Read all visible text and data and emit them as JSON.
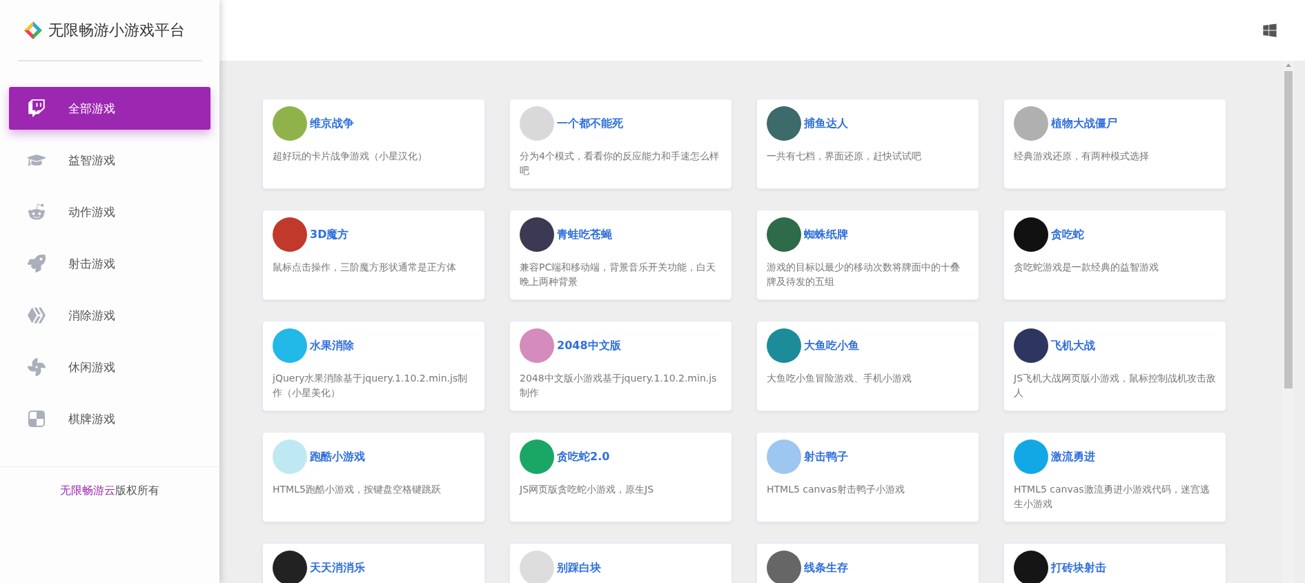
{
  "header": {
    "title": "无限畅游小游戏平台"
  },
  "sidebar": {
    "items": [
      {
        "label": "全部游戏",
        "selected": true
      },
      {
        "label": "益智游戏",
        "selected": false
      },
      {
        "label": "动作游戏",
        "selected": false
      },
      {
        "label": "射击游戏",
        "selected": false
      },
      {
        "label": "消除游戏",
        "selected": false
      },
      {
        "label": "休闲游戏",
        "selected": false
      },
      {
        "label": "棋牌游戏",
        "selected": false
      }
    ],
    "footer": {
      "brand": "无限畅游云",
      "text": "版权所有"
    }
  },
  "games": [
    {
      "title": "维京战争",
      "description": "超好玩的卡片战争游戏（小星汉化）"
    },
    {
      "title": "一个都不能死",
      "description": "分为4个模式，看看你的反应能力和手速怎么样吧"
    },
    {
      "title": "捕鱼达人",
      "description": "一共有七档，界面还原，赶快试试吧"
    },
    {
      "title": "植物大战僵尸",
      "description": "经典游戏还原，有两种模式选择"
    },
    {
      "title": "3D魔方",
      "description": "鼠标点击操作，三阶魔方形状通常是正方体"
    },
    {
      "title": "青蛙吃苍蝇",
      "description": "兼容PC端和移动端，背景音乐开关功能，白天晚上两种背景"
    },
    {
      "title": "蜘蛛纸牌",
      "description": "游戏的目标以最少的移动次数将牌面中的十叠牌及待发的五组"
    },
    {
      "title": "贪吃蛇",
      "description": "贪吃蛇游戏是一款经典的益智游戏"
    },
    {
      "title": "水果消除",
      "description": "jQuery水果消除基于jquery.1.10.2.min.js制作（小星美化）"
    },
    {
      "title": "2048中文版",
      "description": "2048中文版小游戏基于jquery.1.10.2.min.js制作"
    },
    {
      "title": "大鱼吃小鱼",
      "description": "大鱼吃小鱼冒险游戏、手机小游戏"
    },
    {
      "title": "飞机大战",
      "description": "JS飞机大战网页版小游戏，鼠标控制战机攻击敌人"
    },
    {
      "title": "跑酷小游戏",
      "description": "HTML5跑酷小游戏，按键盘空格键跳跃"
    },
    {
      "title": "贪吃蛇2.0",
      "description": "JS网页版贪吃蛇小游戏，原生JS"
    },
    {
      "title": "射击鸭子",
      "description": "HTML5 canvas射击鸭子小游戏"
    },
    {
      "title": "激流勇进",
      "description": "HTML5 canvas激流勇进小游戏代码，迷宫逃生小游戏"
    },
    {
      "title": "天天消消乐"
    },
    {
      "title": "别踩白块"
    },
    {
      "title": "线条生存"
    },
    {
      "title": "打砖块射击"
    }
  ]
}
